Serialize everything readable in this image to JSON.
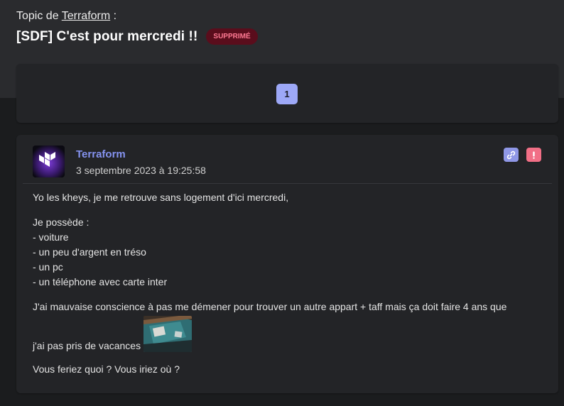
{
  "header": {
    "topic_prefix": "Topic de ",
    "topic_author": "Terraform",
    "topic_suffix": " :",
    "title": "[SDF] C'est pour mercredi !!",
    "badge": "SUPPRIMÉ"
  },
  "pagination": {
    "current_page": "1"
  },
  "post": {
    "author": "Terraform",
    "date": "3 septembre 2023 à 19:25:58",
    "link_icon": "link-icon",
    "report_icon": "exclamation-icon",
    "paragraph1": "Yo les kheys, je me retrouve sans logement d'ici mercredi,",
    "list_intro": "Je possède :",
    "list_items": [
      "- voiture",
      "- un peu d'argent en tréso",
      "- un pc",
      "- un téléphone avec carte inter"
    ],
    "paragraph3": "J'ai mauvaise conscience à pas me démener pour trouver un autre appart + taff mais ça doit faire 4 ans que",
    "paragraph4": "j'ai pas pris de vacances",
    "paragraph5": "Vous feriez quoi ? Vous iriez où ?"
  },
  "colors": {
    "accent": "#8593f0",
    "badge_bg": "#5a0d1c",
    "badge_text": "#ff7a93",
    "report": "#f16f86",
    "page_btn": "#9da8f7"
  }
}
